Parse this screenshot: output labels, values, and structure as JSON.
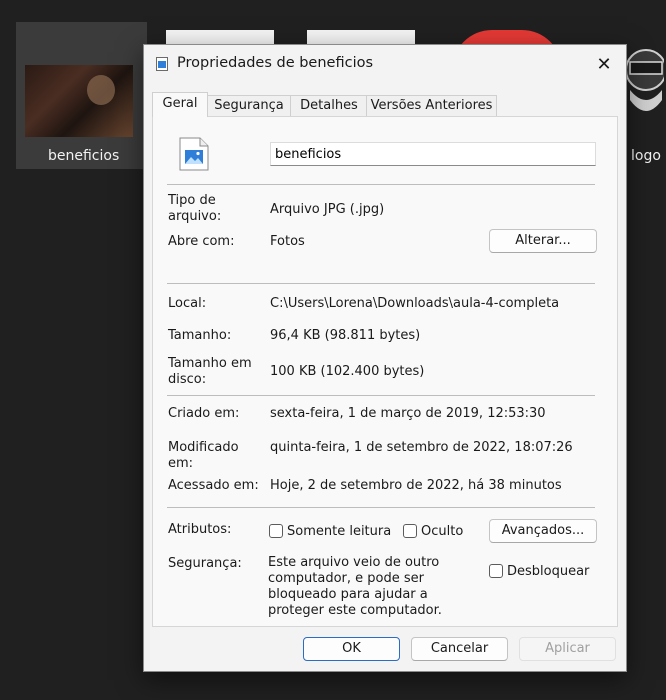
{
  "desktop": {
    "items": [
      {
        "label": "beneficios"
      },
      {
        "label": "logo"
      }
    ]
  },
  "dialog": {
    "title": "Propriedades de beneficios",
    "close_glyph": "✕",
    "tabs": [
      {
        "label": "Geral"
      },
      {
        "label": "Segurança"
      },
      {
        "label": "Detalhes"
      },
      {
        "label": "Versões Anteriores"
      }
    ],
    "file_name": "beneficios",
    "fields": {
      "tipo_label": "Tipo de arquivo:",
      "tipo_value": "Arquivo JPG (.jpg)",
      "abre_label": "Abre com:",
      "abre_value": "Fotos",
      "alterar_button": "Alterar...",
      "local_label": "Local:",
      "local_value": "C:\\Users\\Lorena\\Downloads\\aula-4-completa",
      "tamanho_label": "Tamanho:",
      "tamanho_value": "96,4 KB (98.811 bytes)",
      "tamanho_disco_label": "Tamanho em disco:",
      "tamanho_disco_value": "100 KB (102.400 bytes)",
      "criado_label": "Criado em:",
      "criado_value": "sexta-feira, 1 de março de 2019, 12:53:30",
      "modificado_label": "Modificado em:",
      "modificado_value": "quinta-feira, 1 de setembro de 2022, 18:07:26",
      "acessado_label": "Acessado em:",
      "acessado_value": "Hoje, 2 de setembro de 2022, há 38 minutos",
      "atributos_label": "Atributos:",
      "somente_leitura": "Somente leitura",
      "oculto": "Oculto",
      "avancados_button": "Avançados...",
      "seguranca_label": "Segurança:",
      "seguranca_text": "Este arquivo veio de outro computador, e pode ser bloqueado para ajudar a proteger este computador.",
      "desbloquear": "Desbloquear"
    },
    "footer": {
      "ok": "OK",
      "cancelar": "Cancelar",
      "aplicar": "Aplicar"
    }
  },
  "colors": {
    "background": "#202020",
    "dialog_bg": "#f3f3f3",
    "accent": "#2b6cc4"
  }
}
